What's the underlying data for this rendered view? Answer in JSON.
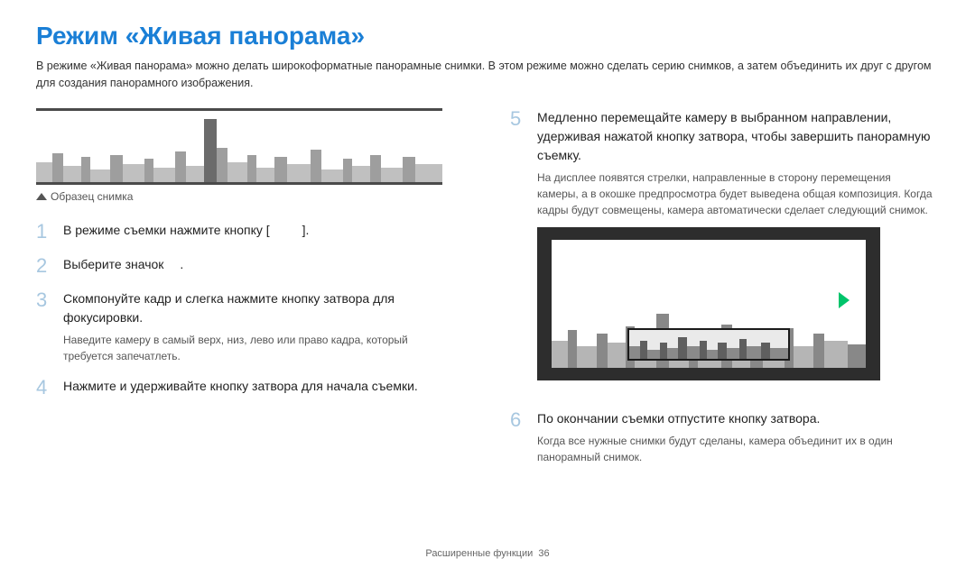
{
  "title": "Режим «Живая панорама»",
  "intro": "В режиме «Живая панорама» можно делать широкоформатные панорамные снимки. В этом режиме можно сделать серию снимков, а затем объединить их друг с другом для создания панорамного изображения.",
  "caption": "Образец снимка",
  "steps_left": [
    {
      "n": "1",
      "main_pre": "В режиме съемки нажмите кнопку [",
      "main_post": "].",
      "sub": ""
    },
    {
      "n": "2",
      "main_pre": "Выберите значок",
      "main_post": ".",
      "sub": ""
    },
    {
      "n": "3",
      "main_pre": "Скомпонуйте кадр и слегка нажмите кнопку затвора для фокусировки.",
      "main_post": "",
      "sub": "Наведите камеру в самый верх, низ, лево или право кадра, который требуется запечатлеть."
    },
    {
      "n": "4",
      "main_pre": "Нажмите и удерживайте кнопку затвора для начала съемки.",
      "main_post": "",
      "sub": ""
    }
  ],
  "steps_right": [
    {
      "n": "5",
      "main_pre": "Медленно перемещайте камеру в выбранном направлении, удерживая нажатой кнопку затвора, чтобы завершить панорамную съемку.",
      "main_post": "",
      "sub": "На дисплее появятся стрелки, направленные в сторону перемещения камеры, а в окошке предпросмотра будет выведена общая композиция. Когда кадры будут совмещены, камера автоматически сделает следующий снимок."
    },
    {
      "n": "6",
      "main_pre": "По окончании съемки отпустите кнопку затвора.",
      "main_post": "",
      "sub": "Когда все нужные снимки будут сделаны, камера объединит их в один панорамный снимок."
    }
  ],
  "footer": {
    "section": "Расширенные функции",
    "page": "36"
  }
}
